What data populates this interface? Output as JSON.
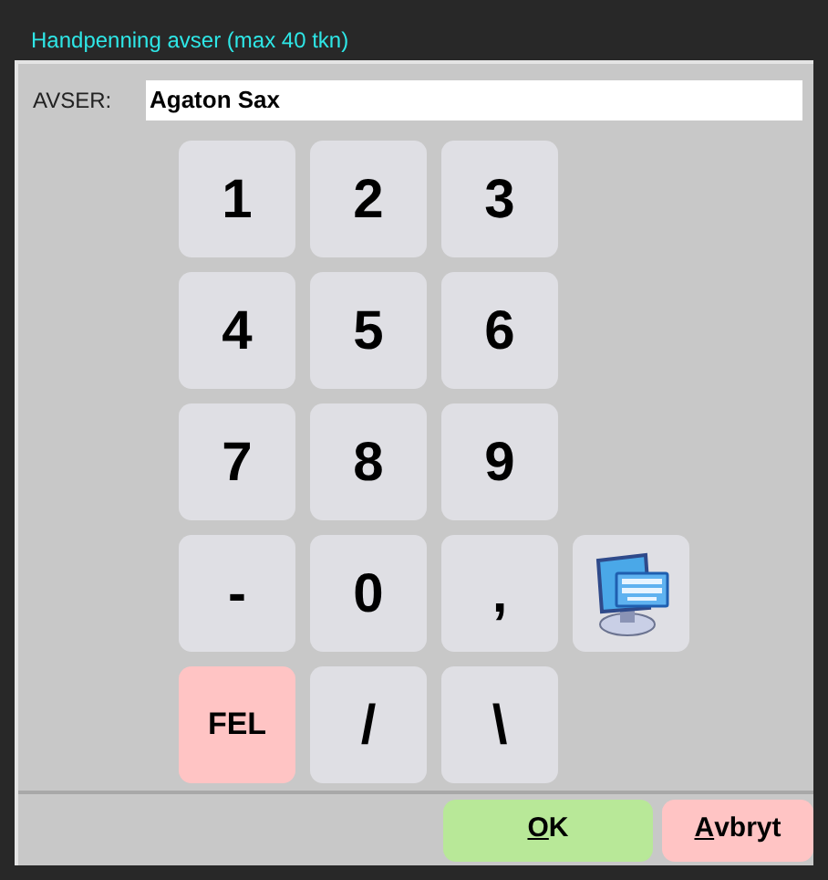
{
  "window": {
    "title": "Handpenning avser (max 40 tkn)"
  },
  "field": {
    "label": "AVSER:",
    "value": "Agaton Sax"
  },
  "keypad": [
    [
      {
        "kind": "key",
        "label": "1"
      },
      {
        "kind": "key",
        "label": "2"
      },
      {
        "kind": "key",
        "label": "3"
      }
    ],
    [
      {
        "kind": "key",
        "label": "4"
      },
      {
        "kind": "key",
        "label": "5"
      },
      {
        "kind": "key",
        "label": "6"
      }
    ],
    [
      {
        "kind": "key",
        "label": "7"
      },
      {
        "kind": "key",
        "label": "8"
      },
      {
        "kind": "key",
        "label": "9"
      }
    ],
    [
      {
        "kind": "key",
        "label": "-"
      },
      {
        "kind": "key",
        "label": "0"
      },
      {
        "kind": "key",
        "label": ","
      },
      {
        "kind": "keyboard"
      }
    ],
    [
      {
        "kind": "clear",
        "label": "FEL"
      },
      {
        "kind": "key",
        "label": "/"
      },
      {
        "kind": "key",
        "label": "\\"
      }
    ]
  ],
  "buttons": [
    {
      "kind": "confirm",
      "mnemonic": "O",
      "rest": "K"
    },
    {
      "kind": "cancel",
      "mnemonic": "A",
      "rest": "vbryt"
    }
  ]
}
